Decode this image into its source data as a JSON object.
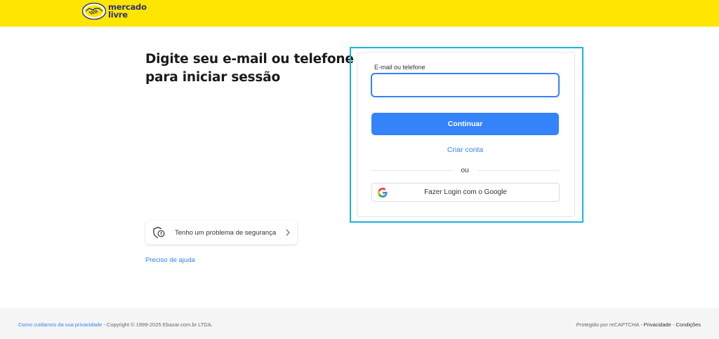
{
  "header": {
    "logo_line1": "mercado",
    "logo_line2": "livre",
    "background_color": "#ffe600"
  },
  "main": {
    "headline_line1": "Digite seu e-mail ou telefone",
    "headline_line2": "para iniciar sessão"
  },
  "login_form": {
    "field_label": "E-mail ou telefone",
    "field_value": "",
    "continue_label": "Continuar",
    "create_account_label": "Criar conta",
    "divider_label": "ou",
    "google_label": "Fazer Login com o Google",
    "accent_color": "#3483fa"
  },
  "security": {
    "label": "Tenho um problema de segurança"
  },
  "help": {
    "label": "Preciso de ajuda"
  },
  "footer": {
    "privacy_link": "Como cuidamos da sua privacidade",
    "copyright": " - Copyright © 1999-2025 Ebazar.com.br LTDA.",
    "recaptcha_text": "Protegido por reCAPTCHA - ",
    "privacy_label": "Privacidade",
    "separator": " - ",
    "terms_label": "Condições"
  }
}
